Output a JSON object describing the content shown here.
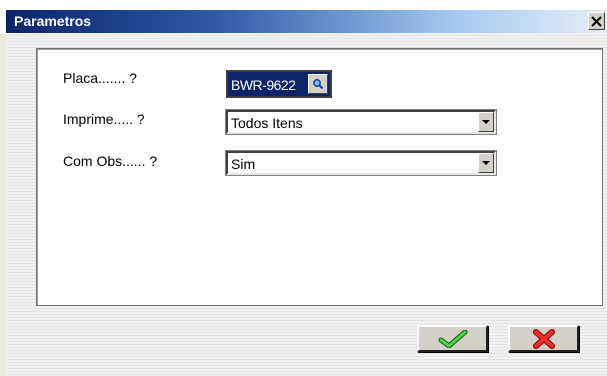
{
  "window": {
    "title": "Parametros"
  },
  "form": {
    "placa": {
      "label": "Placa....... ?",
      "value": "BWR-9622"
    },
    "imprime": {
      "label": "Imprime..... ?",
      "value": "Todos Itens"
    },
    "com_obs": {
      "label": "Com Obs...... ?",
      "value": "Sim"
    }
  },
  "icons": {
    "close": "close-icon",
    "search": "search-icon",
    "dropdown": "chevron-down-icon",
    "ok": "check-icon",
    "cancel": "x-icon"
  },
  "colors": {
    "title_bar": "#0a246a",
    "ok_check": "#2ea82e",
    "cancel_x": "#e02020",
    "selection": "#0a246a"
  }
}
